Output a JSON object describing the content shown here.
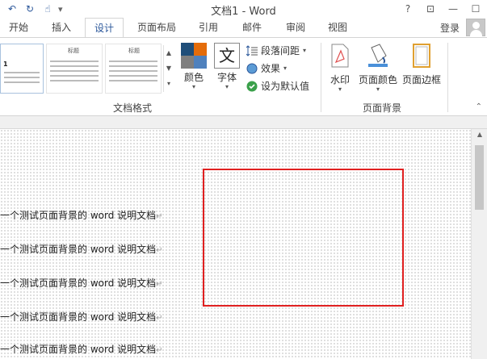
{
  "window": {
    "title": "文档1 - Word",
    "help": "?",
    "restore": "⊡",
    "minimize": "—",
    "maximize": "☐"
  },
  "qat": {
    "undo": "↶",
    "redo": "↻",
    "touch": "☝",
    "customize": "▾"
  },
  "tabs": [
    {
      "label": "开始"
    },
    {
      "label": "插入"
    },
    {
      "label": "设计"
    },
    {
      "label": "页面布局"
    },
    {
      "label": "引用"
    },
    {
      "label": "邮件"
    },
    {
      "label": "审阅"
    },
    {
      "label": "视图"
    }
  ],
  "active_tab": "设计",
  "account": {
    "login": "登录"
  },
  "ribbon": {
    "gallery": {
      "thumb_titles": [
        "标题",
        "标题",
        "标题"
      ],
      "thumb_first_text": "1"
    },
    "colors_label": "颜色",
    "fonts_label": "字体",
    "fonts_glyph": "文",
    "paragraph_spacing": "段落间距",
    "effects": "效果",
    "set_default": "设为默认值",
    "group_document_format": "文档格式",
    "watermark": "水印",
    "page_color": "页面颜色",
    "page_borders": "页面边框",
    "group_page_background": "页面背景"
  },
  "document": {
    "lines": [
      "一个测试页面背景的 word 说明文档",
      "一个测试页面背景的 word 说明文档",
      "一个测试页面背景的 word 说明文档",
      "一个测试页面背景的 word 说明文档",
      "一个测试页面背景的 word 说明文档"
    ],
    "paragraph_mark": "↵"
  },
  "colors": {
    "accent": "#2b579a",
    "highlight_border": "#e02020"
  }
}
